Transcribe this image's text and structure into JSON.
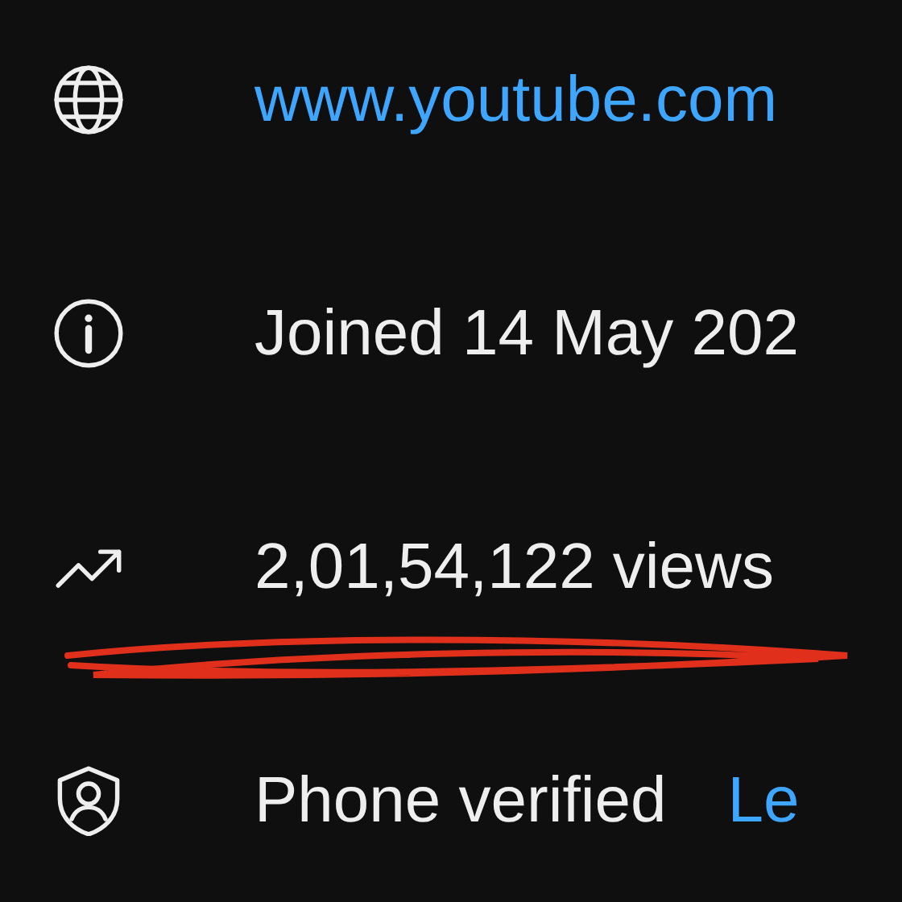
{
  "details": [
    {
      "kind": "website",
      "text": "www.youtube.com",
      "link": true
    },
    {
      "kind": "joined",
      "text": "Joined 14 May 202",
      "link": false
    },
    {
      "kind": "views",
      "text": "2,01,54,122 views",
      "link": false
    },
    {
      "kind": "verified",
      "text": "Phone verified",
      "link": false,
      "action": "Le"
    }
  ]
}
